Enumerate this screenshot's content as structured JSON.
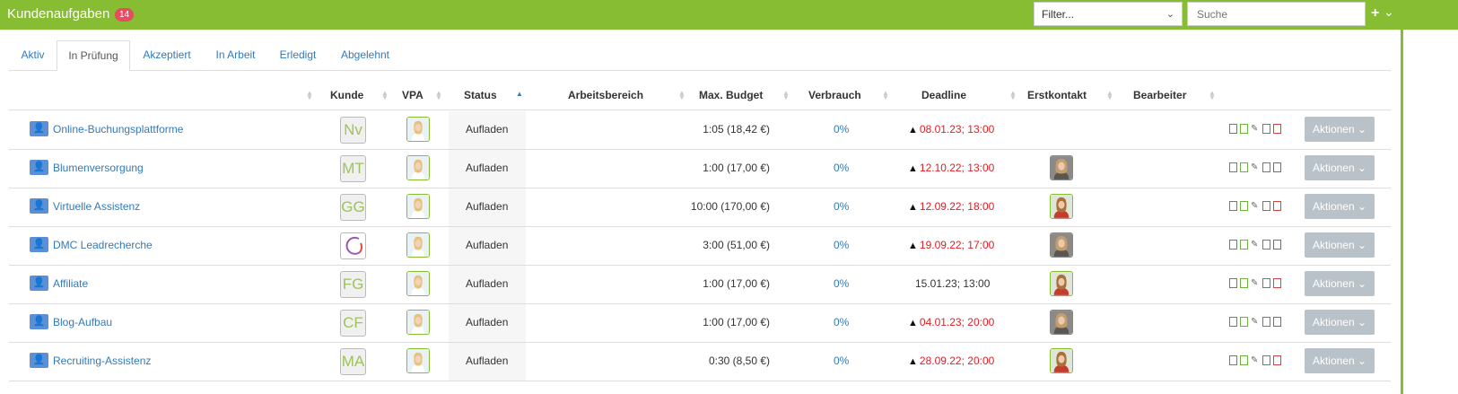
{
  "header": {
    "title": "Kundenaufgaben",
    "badge": "14"
  },
  "filter": {
    "value": "Filter..."
  },
  "search": {
    "placeholder": "Suche"
  },
  "tabs": [
    "Aktiv",
    "In Prüfung",
    "Akzeptiert",
    "In Arbeit",
    "Erledigt",
    "Abgelehnt"
  ],
  "active_tab": "In Prüfung",
  "columns": {
    "kunde": "Kunde",
    "vpa": "VPA",
    "status": "Status",
    "arbeitsbereich": "Arbeitsbereich",
    "budget": "Max. Budget",
    "verbrauch": "Verbrauch",
    "deadline": "Deadline",
    "erstkontakt": "Erstkontakt",
    "bearbeiter": "Bearbeiter"
  },
  "sort_column": "Status",
  "colors": {
    "accent": "#86bd33",
    "badge": "#e74c62",
    "link": "#337ab7",
    "deadline_overdue": "#e31c24"
  },
  "rows": [
    {
      "name": "Online-Buchungsplattforme",
      "kunde": "Nv",
      "kunde_logo": false,
      "status": "Aufladen",
      "budget": "1:05 (18,42 €)",
      "verbrauch": "0%",
      "deadline": "08.01.23; 13:00",
      "overdue": true,
      "erstkontakt": false,
      "erst_style": ""
    },
    {
      "name": "Blumenversorgung",
      "kunde": "MT",
      "kunde_logo": false,
      "status": "Aufladen",
      "budget": "1:00 (17,00 €)",
      "verbrauch": "0%",
      "deadline": "12.10.22; 13:00",
      "overdue": true,
      "erstkontakt": true,
      "erst_style": "dark"
    },
    {
      "name": "Virtuelle Assistenz",
      "kunde": "GG",
      "kunde_logo": false,
      "status": "Aufladen",
      "budget": "10:00 (170,00 €)",
      "verbrauch": "0%",
      "deadline": "12.09.22; 18:00",
      "overdue": true,
      "erstkontakt": true,
      "erst_style": "green"
    },
    {
      "name": "DMC Leadrecherche",
      "kunde": "",
      "kunde_logo": true,
      "status": "Aufladen",
      "budget": "3:00 (51,00 €)",
      "verbrauch": "0%",
      "deadline": "19.09.22; 17:00",
      "overdue": true,
      "erstkontakt": true,
      "erst_style": "dark"
    },
    {
      "name": "Affiliate",
      "kunde": "FG",
      "kunde_logo": false,
      "status": "Aufladen",
      "budget": "1:00 (17,00 €)",
      "verbrauch": "0%",
      "deadline": "15.01.23; 13:00",
      "overdue": false,
      "erstkontakt": true,
      "erst_style": "green"
    },
    {
      "name": "Blog-Aufbau",
      "kunde": "CF",
      "kunde_logo": false,
      "status": "Aufladen",
      "budget": "1:00 (17,00 €)",
      "verbrauch": "0%",
      "deadline": "04.01.23; 20:00",
      "overdue": true,
      "erstkontakt": true,
      "erst_style": "dark"
    },
    {
      "name": "Recruiting-Assistenz",
      "kunde": "MA",
      "kunde_logo": false,
      "status": "Aufladen",
      "budget": "0:30 (8,50 €)",
      "verbrauch": "0%",
      "deadline": "28.09.22; 20:00",
      "overdue": true,
      "erstkontakt": true,
      "erst_style": "green"
    }
  ],
  "action_label": "Aktionen"
}
